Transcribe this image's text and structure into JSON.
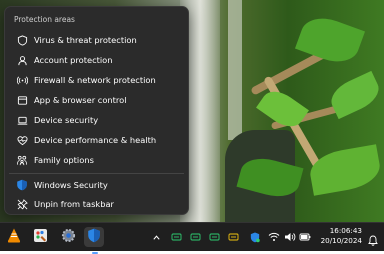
{
  "menu": {
    "header": "Protection areas",
    "items": [
      {
        "label": "Virus & threat protection",
        "icon": "shield-outline-icon"
      },
      {
        "label": "Account protection",
        "icon": "person-icon"
      },
      {
        "label": "Firewall & network protection",
        "icon": "antenna-icon"
      },
      {
        "label": "App & browser control",
        "icon": "app-window-icon"
      },
      {
        "label": "Device security",
        "icon": "laptop-icon"
      },
      {
        "label": "Device performance & health",
        "icon": "heart-icon"
      },
      {
        "label": "Family options",
        "icon": "family-icon"
      }
    ],
    "app_label": "Windows Security",
    "unpin_label": "Unpin from taskbar"
  },
  "taskbar": {
    "apps": [
      "vlc-icon",
      "paint-icon",
      "settings-icon",
      "windows-security-icon"
    ],
    "tray_icons": [
      "chevron-up-icon",
      "network-status-icon",
      "network-status-icon",
      "network-status-icon",
      "network-status-icon",
      "security-shield-icon",
      "wifi-icon",
      "volume-icon",
      "battery-icon"
    ],
    "time": "16:06:43",
    "date": "20/10/2024",
    "accent": "#5aa0ff"
  }
}
